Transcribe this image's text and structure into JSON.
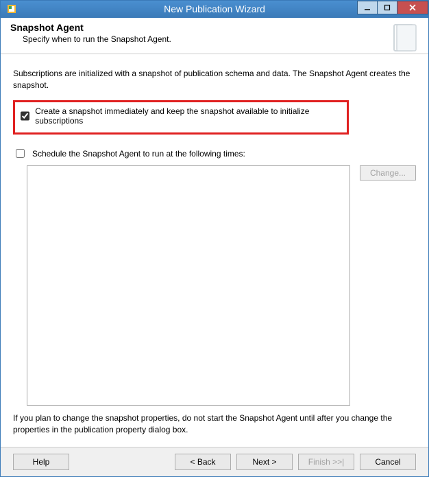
{
  "window": {
    "title": "New Publication Wizard"
  },
  "header": {
    "title": "Snapshot Agent",
    "subtitle": "Specify when to run the Snapshot Agent."
  },
  "body": {
    "intro": "Subscriptions are initialized with a snapshot of publication schema and data. The Snapshot Agent creates the snapshot.",
    "check_immediate": {
      "label": "Create a snapshot immediately and keep the snapshot available to initialize subscriptions",
      "checked": true
    },
    "check_schedule": {
      "label": "Schedule the Snapshot Agent to run at the following times:",
      "checked": false
    },
    "change_button": "Change...",
    "note": "If you plan to change the snapshot properties, do not start the Snapshot Agent until after you change the properties in the publication property dialog box."
  },
  "footer": {
    "help": "Help",
    "back": "< Back",
    "next": "Next >",
    "finish": "Finish >>|",
    "cancel": "Cancel"
  }
}
